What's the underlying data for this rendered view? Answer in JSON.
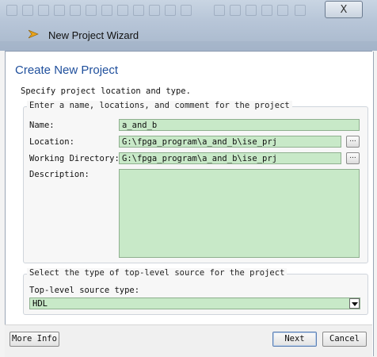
{
  "window": {
    "title": "New Project Wizard",
    "close_glyph": "X"
  },
  "page": {
    "heading": "Create New Project",
    "subtitle": "Specify project location and type."
  },
  "project_group": {
    "legend": "Enter a name, locations, and comment for the project",
    "name_label": "Name:",
    "name_value": "a_and_b",
    "location_label": "Location:",
    "location_value": "G:\\fpga_program\\a_and_b\\ise_prj",
    "workdir_label": "Working Directory:",
    "workdir_value": "G:\\fpga_program\\a_and_b\\ise_prj",
    "browse_glyph": "...",
    "description_label": "Description:",
    "description_value": ""
  },
  "source_group": {
    "legend": "Select the type of top-level source for the project",
    "type_label": "Top-level source type:",
    "type_value": "HDL"
  },
  "footer": {
    "more_info": "More Info",
    "next": "Next",
    "cancel": "Cancel"
  },
  "colors": {
    "field_bg": "#c8e9c8",
    "heading": "#1f4f9c"
  }
}
